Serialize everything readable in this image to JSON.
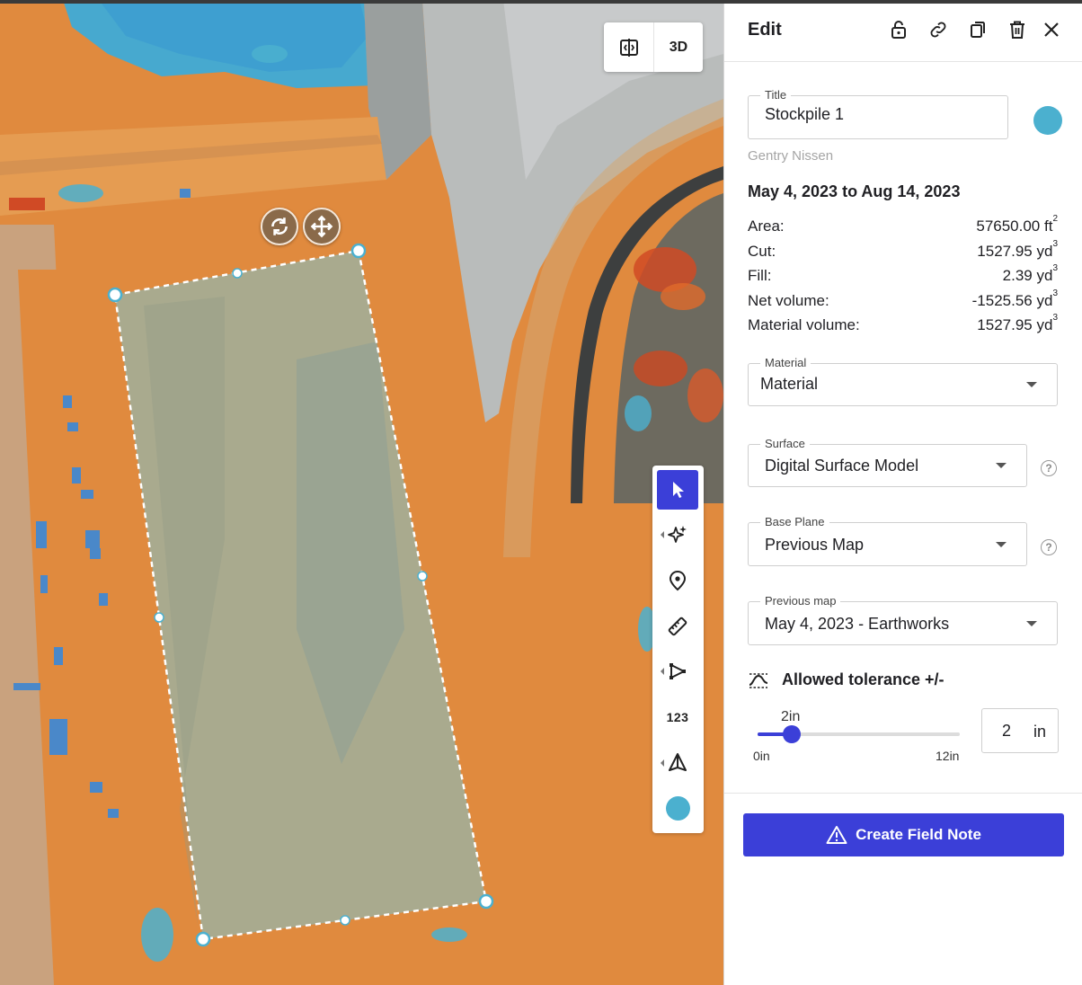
{
  "map": {
    "view_toggle": {
      "split_icon": "split-view-icon",
      "label_3d": "3D"
    },
    "shape_handles": {
      "rotate_icon": "rotate-icon",
      "move_icon": "move-icon"
    },
    "toolbar": {
      "tools": [
        {
          "icon": "cursor-icon",
          "active": true
        },
        {
          "icon": "sparkle-icon"
        },
        {
          "icon": "map-pin-icon"
        },
        {
          "icon": "ruler-icon"
        },
        {
          "icon": "polyline-icon"
        },
        {
          "icon": "count-icon",
          "label": "123"
        },
        {
          "icon": "volume-icon"
        },
        {
          "icon": "color-swatch-icon"
        }
      ]
    },
    "colors": {
      "terrain": "#e08a3e",
      "water": "#4bb0cf",
      "accent": "#3b3fd8"
    }
  },
  "panel": {
    "title": "Edit",
    "header_icons": [
      "lock-icon",
      "link-icon",
      "copy-icon",
      "trash-icon",
      "close-icon"
    ],
    "title_field": {
      "label": "Title",
      "value": "Stockpile 1"
    },
    "color": "#4bb0cf",
    "author": "Gentry Nissen",
    "date_range": "May 4, 2023 to Aug 14, 2023",
    "stats": [
      {
        "label": "Area:",
        "value": "57650.00 ft",
        "sup": "2"
      },
      {
        "label": "Cut:",
        "value": "1527.95 yd",
        "sup": "3"
      },
      {
        "label": "Fill:",
        "value": "2.39 yd",
        "sup": "3"
      },
      {
        "label": "Net volume:",
        "value": "-1525.56 yd",
        "sup": "3"
      },
      {
        "label": "Material volume:",
        "value": "1527.95 yd",
        "sup": "3"
      }
    ],
    "material": {
      "label": "Material",
      "value": "Material"
    },
    "surface": {
      "label": "Surface",
      "value": "Digital Surface Model"
    },
    "base_plane": {
      "label": "Base Plane",
      "value": "Previous Map"
    },
    "previous_map": {
      "label": "Previous map",
      "value": "May 4, 2023 - Earthworks"
    },
    "help_glyph": "?",
    "tolerance": {
      "label": "Allowed tolerance +/-",
      "value_label": "2in",
      "min_label": "0in",
      "max_label": "12in",
      "min": 0,
      "max": 12,
      "value": 2,
      "input_value": "2",
      "unit": "in"
    },
    "cta": {
      "label": "Create Field Note",
      "icon": "warning-triangle-icon"
    }
  }
}
